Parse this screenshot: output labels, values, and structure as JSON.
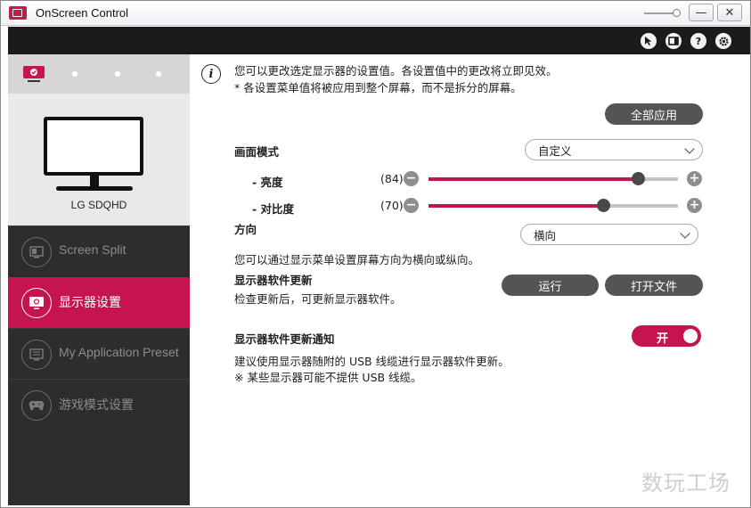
{
  "window": {
    "title": "OnScreen Control",
    "minimize_glyph": "—",
    "close_glyph": "✕"
  },
  "topbar": {
    "icons": [
      "cursor-icon",
      "display-icon",
      "help-icon",
      "settings-icon"
    ],
    "help_glyph": "?"
  },
  "sidebar": {
    "monitor_name": "LG SDQHD",
    "items": [
      {
        "label": "Screen Split",
        "icon": "screen-split-icon",
        "active": false
      },
      {
        "label": "显示器设置",
        "icon": "monitor-settings-icon",
        "active": true
      },
      {
        "label": "My Application Preset",
        "icon": "app-preset-icon",
        "active": false
      },
      {
        "label": "游戏模式设置",
        "icon": "gamepad-icon",
        "active": false
      }
    ]
  },
  "main": {
    "info_line1": "您可以更改选定显示器的设置值。各设置值中的更改将立即见效。",
    "info_line2": "* 各设置菜单值将被应用到整个屏幕，而不是拆分的屏幕。",
    "apply_all_label": "全部应用",
    "picture_mode_label": "画面模式",
    "picture_mode_value": "自定义",
    "brightness_label": "- 亮度",
    "brightness_value": "(84)",
    "brightness_level": 84,
    "contrast_label": "- 对比度",
    "contrast_value": "(70)",
    "contrast_level": 70,
    "minus_glyph": "−",
    "plus_glyph": "+",
    "orientation_label": "方向",
    "orientation_value": "横向",
    "orientation_desc": "您可以通过显示菜单设置屏幕方向为横向或纵向。",
    "firmware_update_label": "显示器软件更新",
    "firmware_update_desc": "检查更新后，可更新显示器软件。",
    "run_label": "运行",
    "open_file_label": "打开文件",
    "update_notice_label": "显示器软件更新通知",
    "update_notice_toggle": "开",
    "update_notice_desc1": "建议使用显示器随附的 USB 线缆进行显示器软件更新。",
    "update_notice_desc2": "※ 某些显示器可能不提供 USB 线缆。"
  },
  "watermark": "数玩工场",
  "colors": {
    "accent": "#c5144f",
    "sidebar_bg": "#2d2d2d",
    "topbar_bg": "#1b1b1b"
  }
}
